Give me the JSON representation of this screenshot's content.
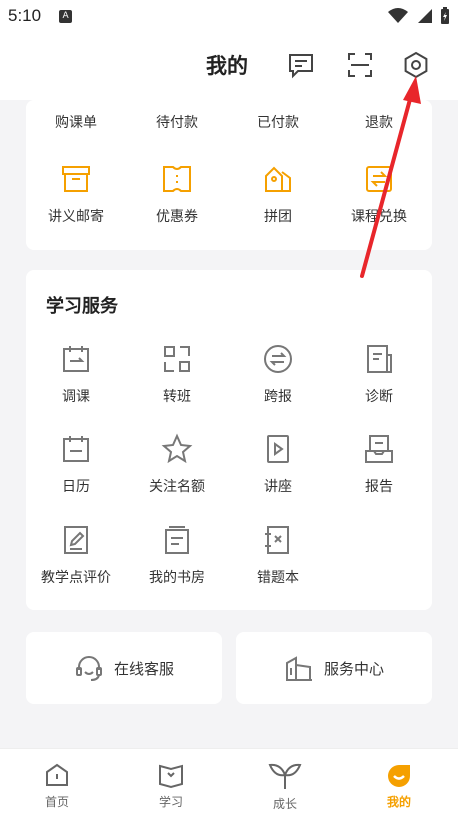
{
  "status": {
    "time": "5:10",
    "a_badge": "A"
  },
  "header": {
    "title": "我的"
  },
  "orders": {
    "row1": [
      "购课单",
      "待付款",
      "已付款",
      "退款"
    ],
    "row2": [
      "讲义邮寄",
      "优惠券",
      "拼团",
      "课程兑换"
    ]
  },
  "learning": {
    "title": "学习服务",
    "items": [
      "调课",
      "转班",
      "跨报",
      "诊断",
      "日历",
      "关注名额",
      "讲座",
      "报告",
      "教学点评价",
      "我的书房",
      "错题本"
    ]
  },
  "service": {
    "online": "在线客服",
    "center": "服务中心"
  },
  "tabs": [
    "首页",
    "学习",
    "成长",
    "我的"
  ],
  "colors": {
    "accent": "#f5a000",
    "annotation": "#e8262b",
    "icon_gray": "#777777"
  }
}
